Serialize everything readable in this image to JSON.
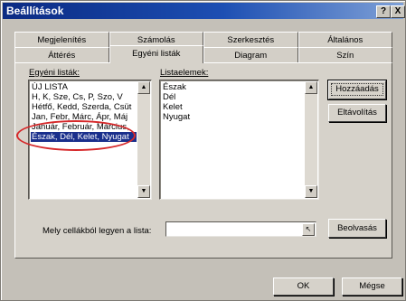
{
  "window": {
    "title": "Beállítások",
    "help_glyph": "?",
    "close_glyph": "X"
  },
  "tabs_row1": [
    "Megjelenítés",
    "Számolás",
    "Szerkesztés",
    "Általános"
  ],
  "tabs_row2": [
    "Áttérés",
    "Egyéni listák",
    "Diagram",
    "Szín"
  ],
  "active_tab": "Egyéni listák",
  "custom_lists": {
    "label": "Egyéni listák:",
    "items": [
      "ÚJ LISTA",
      "H, K, Sze, Cs, P, Szo, V",
      "Hétfő, Kedd, Szerda, Csüt",
      "Jan, Febr, Márc, Ápr, Máj",
      "Január, Február, Március,",
      "Észak, Dél, Kelet, Nyugat"
    ],
    "selected_index": 5
  },
  "list_entries": {
    "label": "Listaelemek:",
    "items": [
      "Észak",
      "Dél",
      "Kelet",
      "Nyugat"
    ]
  },
  "buttons": {
    "add": "Hozzáadás",
    "remove": "Eltávolítás",
    "import": "Beolvasás",
    "ok": "OK",
    "cancel": "Mégse"
  },
  "import_field": {
    "label": "Mely cellákból legyen a lista:",
    "value": ""
  },
  "scroll": {
    "up_glyph": "▲",
    "down_glyph": "▼"
  },
  "colors": {
    "title_bar": "#0a2a83",
    "selection": "#1a2f8c",
    "highlight_circle": "#d6282a"
  }
}
